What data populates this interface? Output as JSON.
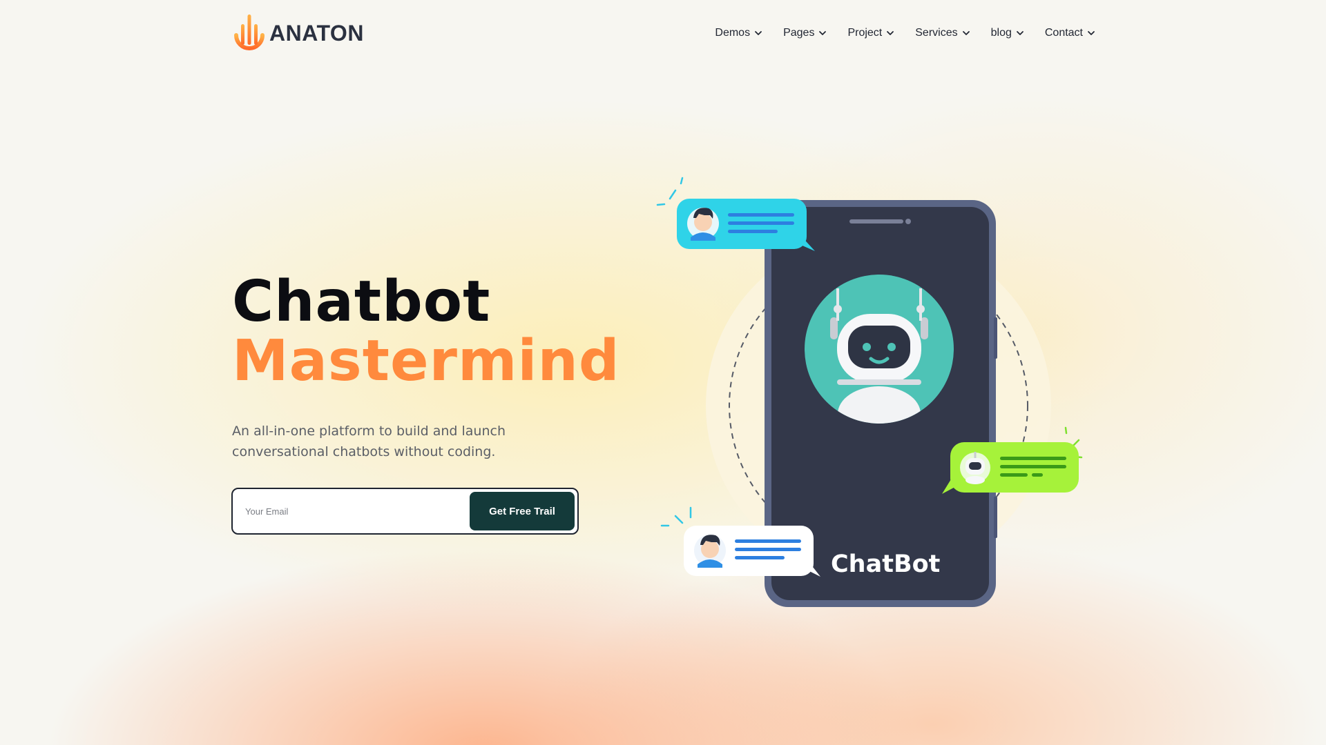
{
  "brand": {
    "name": "ANATON",
    "accent": "#ff8a3d",
    "dark": "#143a3a"
  },
  "nav": [
    {
      "label": "Demos"
    },
    {
      "label": "Pages"
    },
    {
      "label": "Project"
    },
    {
      "label": "Services"
    },
    {
      "label": "blog"
    },
    {
      "label": "Contact"
    }
  ],
  "hero": {
    "title_line1": "Chatbot",
    "title_line2": "Mastermind",
    "subtitle": "An all-in-one platform to build and launch conversational chatbots without coding.",
    "email_placeholder": "Your Email",
    "cta_label": "Get Free Trail"
  },
  "illustration": {
    "phone_label": "ChatBot",
    "icons": [
      "robot-avatar-icon",
      "user-avatar-icon",
      "bot-avatar-icon"
    ]
  }
}
